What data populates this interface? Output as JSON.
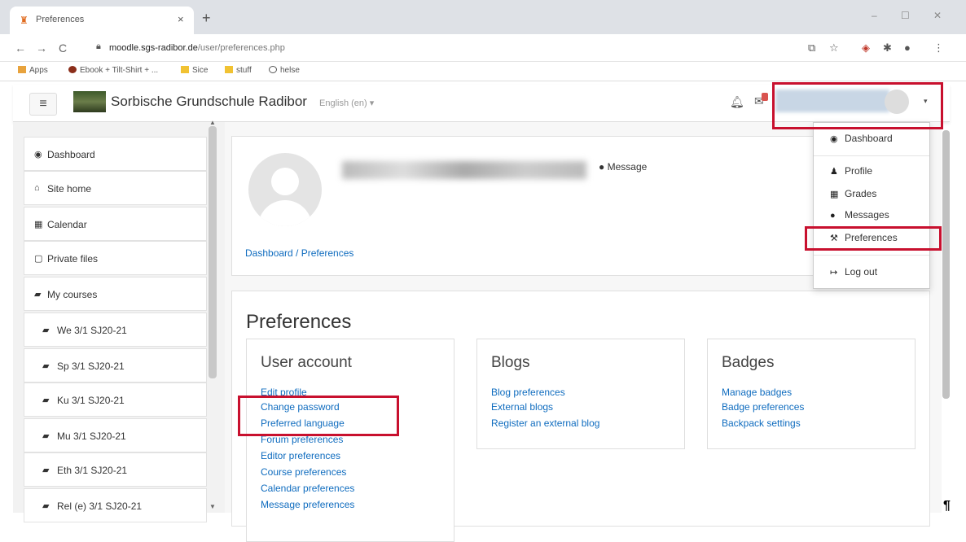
{
  "browser": {
    "tab_title": "Preferences",
    "tab_close": "×",
    "new_tab": "+",
    "window_controls": [
      "–",
      "☐",
      "✕"
    ],
    "back": "←",
    "forward": "→",
    "reload": "C",
    "url_host": "moodle.sgs-radibor.de",
    "url_path": "/user/preferences.php",
    "bookmarks": [
      "Apps",
      "Ebook + Tilt-Shirt + ...",
      "Sice",
      "stuff",
      "helse"
    ]
  },
  "navbar": {
    "menu_glyph": "≡",
    "site_name": "Sorbische Grundschule Radibor",
    "language": "English (en) ▾",
    "user_caret": "▾"
  },
  "drawer": {
    "items": [
      {
        "icon": "tachometer-icon",
        "glyph": "◉",
        "label": "Dashboard"
      },
      {
        "icon": "home-icon",
        "glyph": "⌂",
        "label": "Site home"
      },
      {
        "icon": "calendar-icon",
        "glyph": "▦",
        "label": "Calendar"
      },
      {
        "icon": "file-icon",
        "glyph": "▢",
        "label": "Private files"
      },
      {
        "icon": "graduation-cap-icon",
        "glyph": "▰",
        "label": "My courses"
      },
      {
        "icon": "graduation-cap-icon",
        "glyph": "▰",
        "label": "We 3/1 SJ20-21"
      },
      {
        "icon": "graduation-cap-icon",
        "glyph": "▰",
        "label": "Sp 3/1 SJ20-21"
      },
      {
        "icon": "graduation-cap-icon",
        "glyph": "▰",
        "label": "Ku 3/1 SJ20-21"
      },
      {
        "icon": "graduation-cap-icon",
        "glyph": "▰",
        "label": "Mu 3/1 SJ20-21"
      },
      {
        "icon": "graduation-cap-icon",
        "glyph": "▰",
        "label": "Eth 3/1 SJ20-21"
      },
      {
        "icon": "graduation-cap-icon",
        "glyph": "▰",
        "label": "Rel (e) 3/1 SJ20-21"
      }
    ]
  },
  "header": {
    "message_label": "Message",
    "message_glyph": "●",
    "breadcrumb": "Dashboard / Preferences"
  },
  "preferences": {
    "title": "Preferences",
    "user_account": {
      "heading": "User account",
      "links": [
        "Edit profile",
        "Change password",
        "Preferred language",
        "Forum preferences",
        "Editor preferences",
        "Course preferences",
        "Calendar preferences",
        "Message preferences"
      ]
    },
    "blogs": {
      "heading": "Blogs",
      "links": [
        "Blog preferences",
        "External blogs",
        "Register an external blog"
      ]
    },
    "badges": {
      "heading": "Badges",
      "links": [
        "Manage badges",
        "Badge preferences",
        "Backpack settings"
      ]
    }
  },
  "user_menu": {
    "items": [
      {
        "icon": "tachometer-icon",
        "glyph": "◉",
        "label": "Dashboard"
      },
      {
        "icon": "user-icon",
        "glyph": "♟",
        "label": "Profile"
      },
      {
        "icon": "table-icon",
        "glyph": "▦",
        "label": "Grades"
      },
      {
        "icon": "comment-icon",
        "glyph": "●",
        "label": "Messages"
      },
      {
        "icon": "wrench-icon",
        "glyph": "⚒",
        "label": "Preferences"
      },
      {
        "icon": "sign-out-icon",
        "glyph": "↦",
        "label": "Log out"
      }
    ]
  },
  "annotation_color": "#c8102e",
  "link_color": "#0f6cbf",
  "pilcrow": "¶"
}
